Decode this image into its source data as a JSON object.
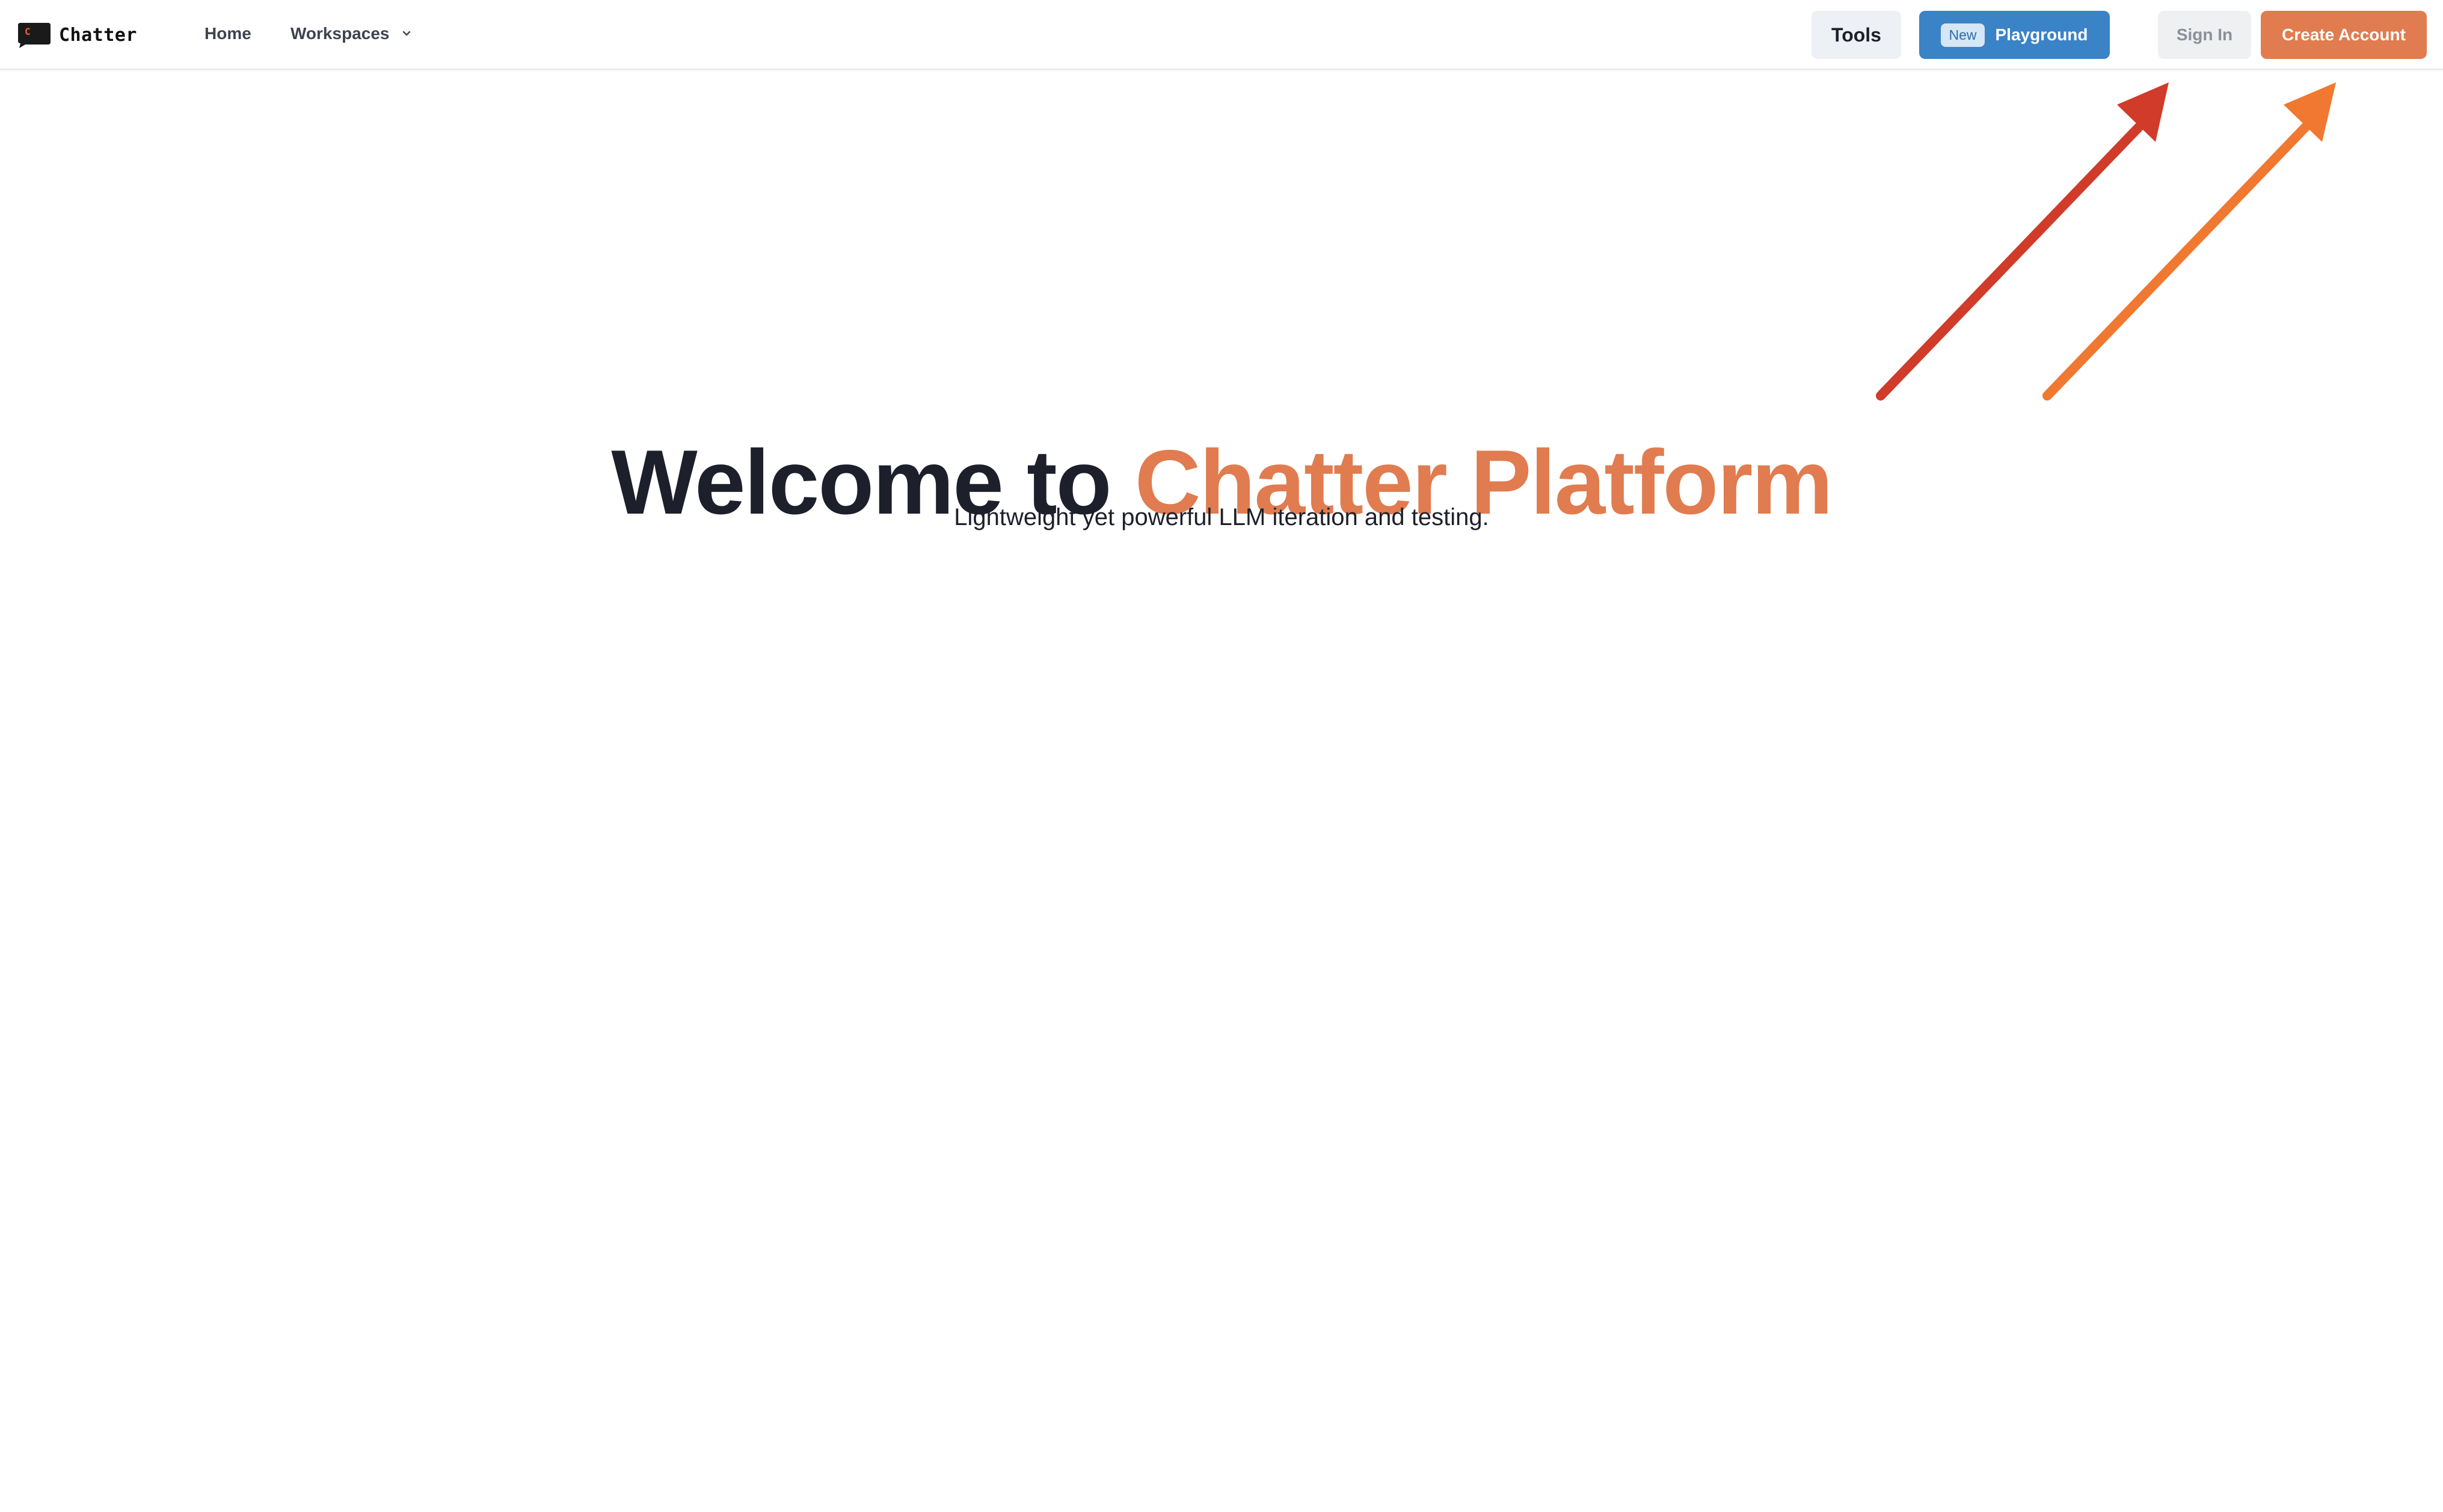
{
  "app": {
    "brand_name": "Chatter",
    "logo_letter": "C"
  },
  "nav": {
    "home_label": "Home",
    "workspaces_label": "Workspaces"
  },
  "toolbar": {
    "tools_label": "Tools",
    "new_badge": "New",
    "playground_label": "Playground",
    "sign_in_label": "Sign In",
    "create_account_label": "Create Account"
  },
  "hero": {
    "title_prefix": "Welcome to",
    "title_accent": "Chatter Platform",
    "subtitle": "Lightweight yet powerful LLM iteration and testing."
  },
  "colors": {
    "accent": "#e07c4f",
    "primary_blue": "#3a83c7",
    "text_dark": "#1d202b",
    "arrow_red": "#d03b2a",
    "arrow_orange": "#f07830"
  },
  "icons": {
    "logo": "chat-logo-icon",
    "dropdown": "chevron-down-icon",
    "annotation_arrows": "arrow-annotation-icon"
  }
}
